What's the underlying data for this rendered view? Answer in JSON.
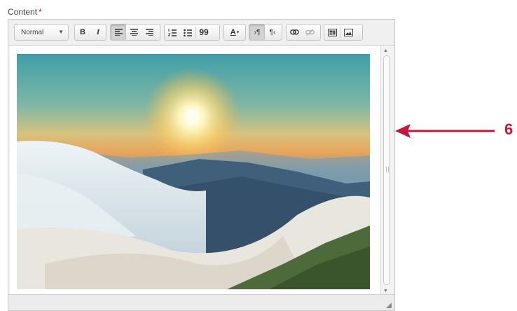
{
  "field": {
    "label": "Content",
    "required_mark": "*"
  },
  "toolbar": {
    "format_value": "Normal",
    "bold": "B",
    "italic": "I",
    "align_left_active": true,
    "source_ltr_active": true,
    "blockquote": "99",
    "text_color": "A"
  },
  "callout": {
    "number": "6",
    "color": "#c5163b"
  },
  "colors": {
    "accent": "#c5163b",
    "required": "#d0021b"
  }
}
